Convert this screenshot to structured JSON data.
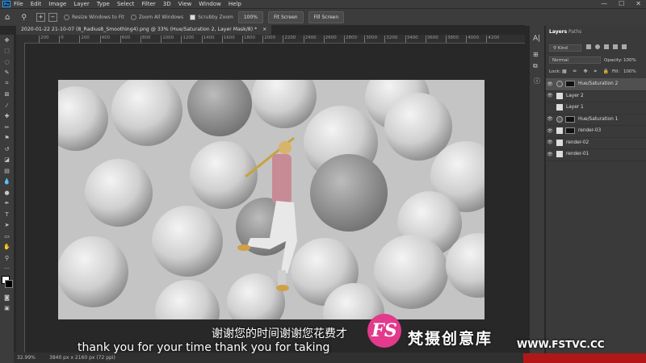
{
  "menu": {
    "app_icon": "Ps",
    "items": [
      "File",
      "Edit",
      "Image",
      "Layer",
      "Type",
      "Select",
      "Filter",
      "3D",
      "View",
      "Window",
      "Help"
    ],
    "window_controls": [
      "—",
      "☐",
      "✕"
    ]
  },
  "options_bar": {
    "resize_windows": "Resize Windows to Fit",
    "zoom_all": "Zoom All Windows",
    "scrubby_zoom": "Scrubby Zoom",
    "zoom_value": "100%",
    "fit_screen": "Fit Screen",
    "fill_screen": "Fill Screen"
  },
  "document": {
    "tab_title": "2020-01-22 21-10-07 (8_Radius8_Smoothing4).png @ 33% (Hue/Saturation 2, Layer Mask/8) *",
    "close": "×"
  },
  "ruler_labels": [
    "200",
    "0",
    "200",
    "400",
    "600",
    "800",
    "1000",
    "1200",
    "1400",
    "1600",
    "1800",
    "2000",
    "2200",
    "2400",
    "2600",
    "2800",
    "3000",
    "3200",
    "3400",
    "3600",
    "3800",
    "4000",
    "4200"
  ],
  "status": {
    "zoom": "32.99%",
    "doc_info": "3840 px x 2160 px (72 ppi)"
  },
  "panel": {
    "tabs": [
      "Layers",
      "Paths"
    ],
    "kind": "Kind",
    "blend_mode": "Normal",
    "opacity_label": "Opacity:",
    "opacity_value": "100%",
    "lock_label": "Lock:",
    "fill_label": "Fill:",
    "fill_value": "100%",
    "layers": [
      {
        "name": "Hue/Saturation 2",
        "type": "adjustment",
        "visible": true,
        "selected": true
      },
      {
        "name": "Layer 2",
        "type": "pixel",
        "visible": true,
        "selected": false
      },
      {
        "name": "Layer 1",
        "type": "pixel",
        "visible": false,
        "selected": false
      },
      {
        "name": "Hue/Saturation 1",
        "type": "adjustment",
        "visible": true,
        "selected": false
      },
      {
        "name": "render-03",
        "type": "pixel",
        "visible": true,
        "selected": false
      },
      {
        "name": "render-02",
        "type": "pixel",
        "visible": true,
        "selected": false
      },
      {
        "name": "render-01",
        "type": "pixel",
        "visible": true,
        "selected": false
      }
    ]
  },
  "subtitles": {
    "chinese": "谢谢您的时间谢谢您花费才",
    "english": "thank you for your time thank you for taking"
  },
  "watermark": {
    "logo": "FS",
    "brand": "梵摄创意库",
    "url": "WWW.FSTVC.CC"
  }
}
